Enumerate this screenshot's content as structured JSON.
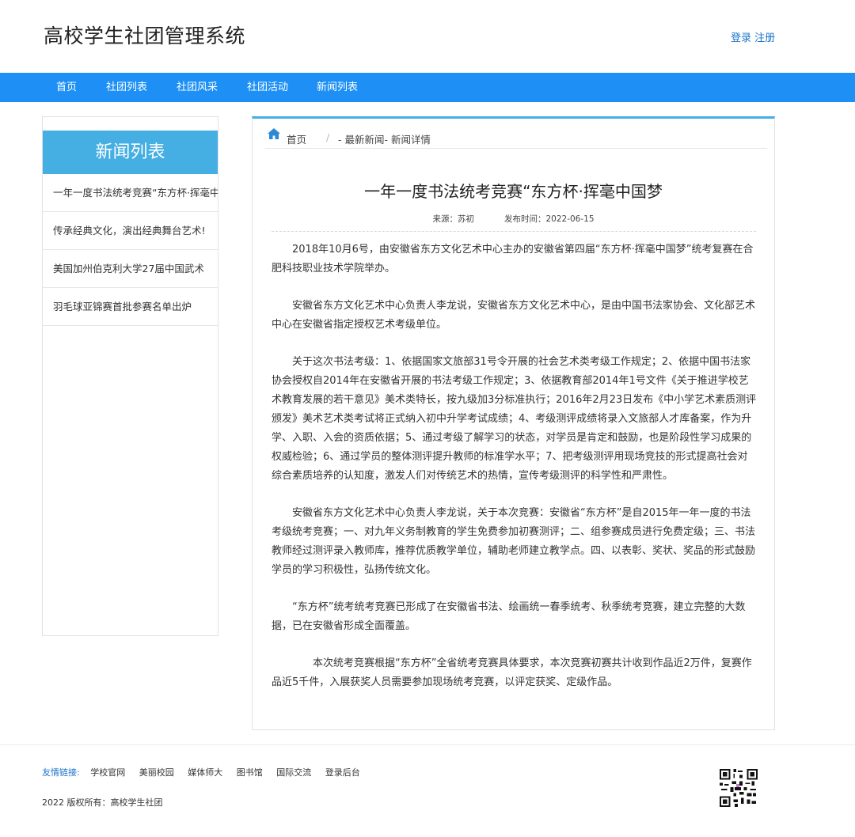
{
  "header": {
    "site_title": "高校学生社团管理系统",
    "login": "登录",
    "register": "注册"
  },
  "nav": {
    "items": [
      "首页",
      "社团列表",
      "社团风采",
      "社团活动",
      "新闻列表"
    ]
  },
  "sidebar": {
    "title": "新闻列表",
    "items": [
      "一年一度书法统考竞赛“东方杯·挥毫中国梦",
      "传承经典文化，演出经典舞台艺术!",
      "美国加州伯克利大学27届中国武术",
      "羽毛球亚锦赛首批参赛名单出炉"
    ]
  },
  "breadcrumb": {
    "home": "首页",
    "sep": "/",
    "rest": "- 最新新闻- 新闻详情"
  },
  "article": {
    "title": "一年一度书法统考竞赛“东方杯·挥毫中国梦",
    "source_label": "来源：",
    "source": "苏初",
    "date_label": "发布时间：",
    "date": "2022-06-15",
    "paragraphs": [
      "2018年10月6号，由安徽省东方文化艺术中心主办的安徽省第四届“东方杯·挥毫中国梦”统考复赛在合肥科技职业技术学院举办。",
      "安徽省东方文化艺术中心负责人李龙说，安徽省东方文化艺术中心，是由中国书法家协会、文化部艺术中心在安徽省指定授权艺术考级单位。",
      "关于这次书法考级：1、依据国家文旅部31号令开展的社会艺术类考级工作规定；2、依据中国书法家协会授权自2014年在安徽省开展的书法考级工作规定；3、依据教育部2014年1号文件《关于推进学校艺术教育发展的若干意见》美术类特长，按九级加3分标准执行；2016年2月23日发布《中小学艺术素质测评颁发》美术艺术类考试将正式纳入初中升学考试成绩；4、考级测评成绩将录入文旅部人才库备案，作为升学、入职、入会的资质依据；5、通过考级了解学习的状态，对学员是肯定和鼓励，也是阶段性学习成果的权威检验；6、通过学员的整体测评提升教师的标准学水平；7、把考级测评用现场竞技的形式提高社会对综合素质培养的认知度，激发人们对传统艺术的热情，宣传考级测评的科学性和严肃性。",
      "安徽省东方文化艺术中心负责人李龙说，关于本次竞赛：安徽省“东方杯”是自2015年一年一度的书法考级统考竞赛；一、对九年义务制教育的学生免费参加初赛测评；二、组参赛成员进行免费定级；三、书法教师经过测评录入教师库，推荐优质教学单位，辅助老师建立教学点。四、以表彰、奖状、奖品的形式鼓励学员的学习积极性，弘扬传统文化。",
      "“东方杯”统考统考竞赛已形成了在安徽省书法、绘画统一春季统考、秋季统考竞赛，建立完整的大数据，已在安徽省形成全面覆盖。",
      "本次统考竞赛根据“东方杯”全省统考竞赛具体要求，本次竞赛初赛共计收到作品近2万件，复赛作品近5千件，入展获奖人员需要参加现场统考竞赛，以评定获奖、定级作品。"
    ]
  },
  "footer": {
    "links_label": "友情链接:",
    "links": [
      "学校官网",
      "美丽校园",
      "媒体师大",
      "图书馆",
      "国际交流",
      "登录后台"
    ],
    "copyright": "2022 版权所有：高校学生社团"
  },
  "colors": {
    "nav_bg": "#1e90f5",
    "sidebar_head_bg": "#45aee3",
    "link_blue": "#1a73c9"
  }
}
